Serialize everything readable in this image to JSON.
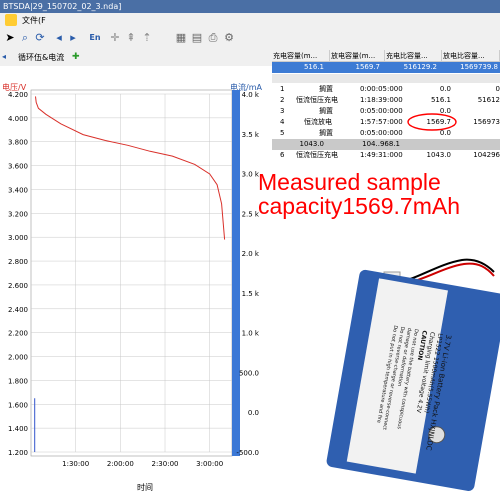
{
  "window": {
    "title": "BTSDA|29_150702_02_3.nda]"
  },
  "menu": {
    "file": "文件(F"
  },
  "toolbar": {
    "en_label": "En"
  },
  "tabs": [
    {
      "label": "循环伍&电流"
    }
  ],
  "chart": {
    "y_left_label": "电压/V",
    "y_right_label": "电流/mA",
    "x_label": "时间",
    "accent_color": "#d9302a",
    "current_color": "#3355cc"
  },
  "chart_data": {
    "type": "line",
    "xlabel": "时间",
    "ylabel": "电压/V",
    "y2label": "电流/mA",
    "ylim": [
      1.2,
      4.2
    ],
    "y2lim": [
      -500,
      4000
    ],
    "yticks": [
      "4.200",
      "4.000",
      "3.800",
      "3.600",
      "3.400",
      "3.200",
      "3.000",
      "2.800",
      "2.600",
      "2.400",
      "2.200",
      "2.000",
      "1.800",
      "1.600",
      "1.400",
      "1.200"
    ],
    "y2ticks": [
      "4.0 k",
      "3.5 k",
      "3.0 k",
      "2.5 k",
      "2.0 k",
      "1.5 k",
      "1.0 k",
      "500.0",
      "0.0",
      "-500.0"
    ],
    "xticks": [
      "1:30:00",
      "2:00:00",
      "2:30:00",
      "3:00:00"
    ],
    "series": [
      {
        "x": [
          63.0,
          63.5,
          65,
          70,
          80,
          95,
          110,
          125,
          140,
          155,
          170,
          180,
          185,
          188,
          190
        ],
        "y": [
          4.18,
          4.13,
          4.08,
          4.03,
          3.95,
          3.86,
          3.81,
          3.77,
          3.72,
          3.68,
          3.61,
          3.53,
          3.44,
          3.28,
          2.98
        ]
      },
      {
        "x": [
          62.5,
          62.5,
          62.5,
          62.5
        ],
        "y": [
          1.2,
          1.65,
          1.65,
          1.2
        ]
      }
    ]
  },
  "table": {
    "headers": [
      "充电容量(m...",
      "放电容量(m...",
      "充电比容量...",
      "放电比容量..."
    ],
    "top_row": [
      "516.1",
      "1569.7",
      "516129.2",
      "1569739.8"
    ],
    "rows": [
      {
        "no": "1",
        "name": "搁置",
        "time": "0:00:05:000",
        "cap": "0.0",
        "spec": "0"
      },
      {
        "no": "2",
        "name": "恒流恒压充电",
        "time": "1:18:39:000",
        "cap": "516.1",
        "spec": "51612"
      },
      {
        "no": "3",
        "name": "搁置",
        "time": "0:05:00:000",
        "cap": "0.0",
        "spec": ""
      },
      {
        "no": "4",
        "name": "恒流放电",
        "time": "1:57:57:000",
        "cap": "1569.7",
        "spec": "156973"
      },
      {
        "no": "5",
        "name": "搁置",
        "time": "0:05:00:000",
        "cap": "0.0",
        "spec": ""
      },
      {
        "no": "",
        "name": "",
        "time": "",
        "cap": "1043.0",
        "spec": "104..968.1"
      },
      {
        "no": "6",
        "name": "恒流恒压充电",
        "time": "1:49:31:000",
        "cap": "1043.0",
        "spec": "104296"
      }
    ],
    "highlight_color": "#ff0000"
  },
  "caption": {
    "line1": "Measured sample",
    "line2": "capacity1569.7mAh"
  },
  "battery": {
    "label_lines": [
      "3.7V Li-ion Battery Pack HXJNLDC",
      "LP1522 1500mAh(5.55Wh)",
      "Charging limit voltage 4.2V",
      "CAUTION",
      "Do not use the battery with conspicuous",
      "damage or deformation",
      "Do not reverse-charge or reverse-connect",
      "Do not put in high temperature and fire"
    ]
  }
}
